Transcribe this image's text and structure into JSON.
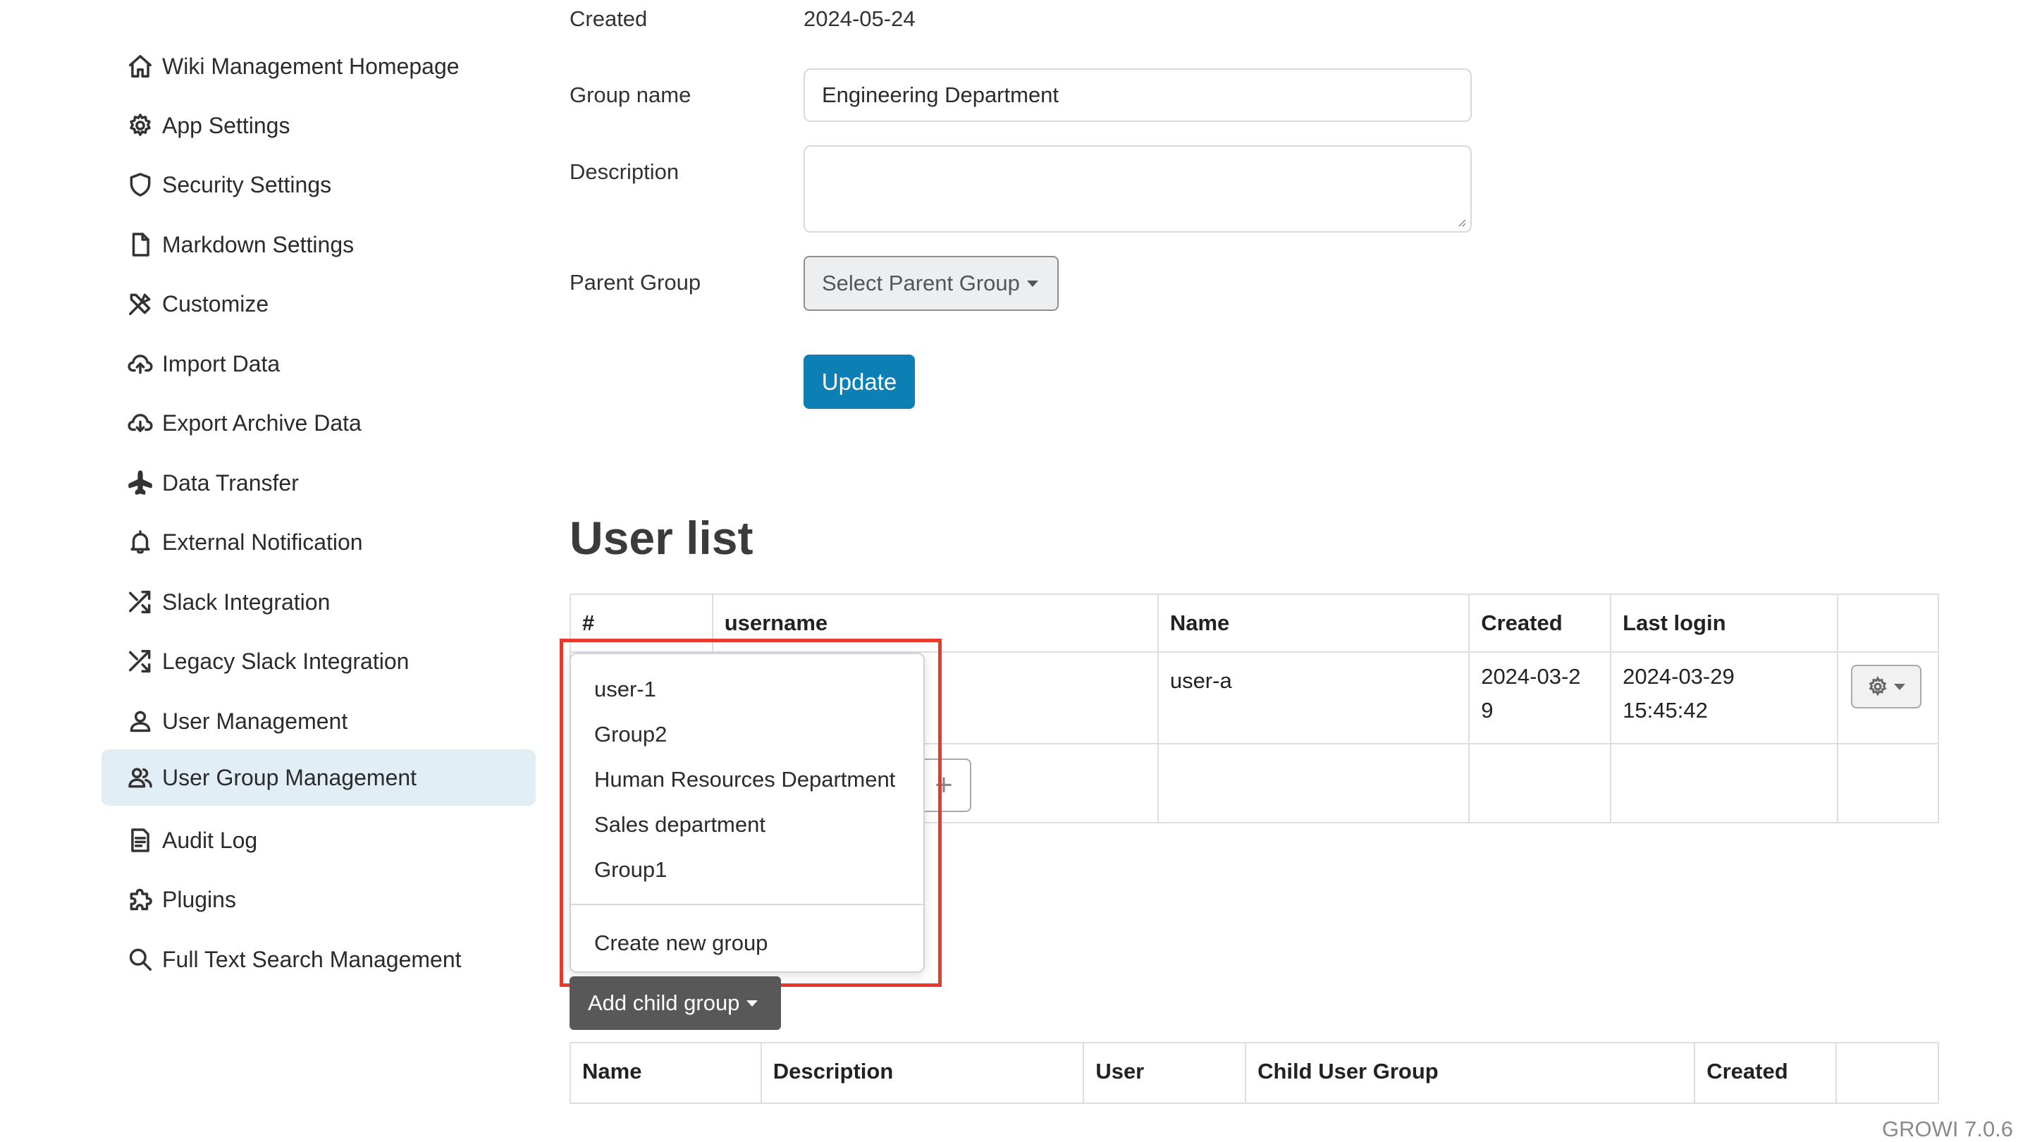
{
  "sidebar": {
    "items": [
      {
        "label": "Wiki Management Homepage",
        "icon": "home-icon"
      },
      {
        "label": "App Settings",
        "icon": "gear-icon"
      },
      {
        "label": "Security Settings",
        "icon": "shield-icon"
      },
      {
        "label": "Markdown Settings",
        "icon": "file-icon"
      },
      {
        "label": "Customize",
        "icon": "tools-icon"
      },
      {
        "label": "Import Data",
        "icon": "cloud-upload-icon"
      },
      {
        "label": "Export Archive Data",
        "icon": "cloud-download-icon"
      },
      {
        "label": "Data Transfer",
        "icon": "airplane-icon"
      },
      {
        "label": "External Notification",
        "icon": "bell-icon"
      },
      {
        "label": "Slack Integration",
        "icon": "shuffle-icon"
      },
      {
        "label": "Legacy Slack Integration",
        "icon": "shuffle-icon"
      },
      {
        "label": "User Management",
        "icon": "person-icon"
      },
      {
        "label": "User Group Management",
        "icon": "people-icon"
      },
      {
        "label": "Audit Log",
        "icon": "document-icon"
      },
      {
        "label": "Plugins",
        "icon": "puzzle-icon"
      },
      {
        "label": "Full Text Search Management",
        "icon": "search-icon"
      }
    ],
    "active_index": 12
  },
  "form": {
    "created_label": "Created",
    "created_value": "2024-05-24",
    "group_name_label": "Group name",
    "group_name_value": "Engineering Department",
    "description_label": "Description",
    "description_value": "",
    "parent_group_label": "Parent Group",
    "parent_group_select": "Select Parent Group",
    "update_button": "Update"
  },
  "user_list": {
    "title": "User list",
    "headers": [
      "#",
      "username",
      "Name",
      "Created",
      "Last login",
      ""
    ],
    "rows": [
      {
        "name": "user-a",
        "created": "2024-03-29",
        "last_login": "2024-03-29 15:45:42"
      }
    ]
  },
  "dropdown": {
    "items": [
      "user-1",
      "Group2",
      "Human Resources Department",
      "Sales department",
      "Group1"
    ],
    "create_item": "Create new group"
  },
  "child_groups": {
    "add_button": "Add child group",
    "headers": [
      "Name",
      "Description",
      "User",
      "Child User Group",
      "Created",
      ""
    ]
  },
  "footer": {
    "version": "GROWI 7.0.6"
  },
  "colors": {
    "accent": "#0c7fb4",
    "active_bg": "#e2eef6",
    "highlight": "#e83a2c",
    "dark_button": "#585858"
  }
}
